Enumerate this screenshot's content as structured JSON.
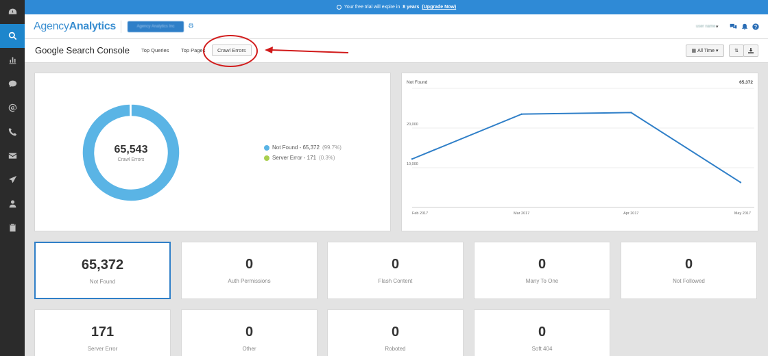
{
  "banner": {
    "prefix": "Your free trial will expire in",
    "period": "8 years",
    "link": "(Upgrade Now)"
  },
  "header": {
    "logo_light": "Agency",
    "logo_bold": "Analytics",
    "account_name": "Agency Analytics Inc",
    "user_name": "user name"
  },
  "sidebar": {
    "items": [
      {
        "icon": "dashboard-icon",
        "active": false
      },
      {
        "icon": "search-icon",
        "active": true
      },
      {
        "icon": "bar-chart-icon",
        "active": false
      },
      {
        "icon": "chat-icon",
        "active": false
      },
      {
        "icon": "at-sign-icon",
        "active": false
      },
      {
        "icon": "phone-icon",
        "active": false
      },
      {
        "icon": "email-icon",
        "active": false
      },
      {
        "icon": "send-icon",
        "active": false
      },
      {
        "icon": "user-icon",
        "active": false
      },
      {
        "icon": "clipboard-icon",
        "active": false
      }
    ]
  },
  "subheader": {
    "title": "Google Search Console",
    "tabs": [
      "Top Queries",
      "Top Pages",
      "Crawl Errors"
    ],
    "active_tab": "Crawl Errors",
    "date_range": "All Time",
    "colors": {
      "annotation": "#d11a1a"
    }
  },
  "donut": {
    "total": "65,543",
    "caption": "Crawl Errors",
    "legend": [
      {
        "label": "Not Found - 65,372",
        "pct": "(99.7%)",
        "color": "#5ab4e5"
      },
      {
        "label": "Server Error - 171",
        "pct": "(0.3%)",
        "color": "#a9cf4f"
      }
    ]
  },
  "line_chart": {
    "title": "Not Found",
    "total": "65,372"
  },
  "chart_data": [
    {
      "type": "pie",
      "title": "Crawl Errors",
      "categories": [
        "Not Found",
        "Server Error"
      ],
      "values": [
        65372,
        171
      ],
      "colors": [
        "#5ab4e5",
        "#a9cf4f"
      ]
    },
    {
      "type": "line",
      "title": "Not Found",
      "x": [
        "Feb 2017",
        "Mar 2017",
        "Apr 2017",
        "May 2017"
      ],
      "series": [
        {
          "name": "Not Found",
          "values": [
            12200,
            23500,
            23900,
            6300
          ]
        }
      ],
      "y_ticks": [
        "10,000",
        "20,000"
      ],
      "ylim": [
        0,
        30000
      ],
      "color": "#2f7fc8"
    }
  ],
  "stats": [
    {
      "value": "65,372",
      "label": "Not Found",
      "selected": true
    },
    {
      "value": "0",
      "label": "Auth Permissions",
      "selected": false
    },
    {
      "value": "0",
      "label": "Flash Content",
      "selected": false
    },
    {
      "value": "0",
      "label": "Many To One",
      "selected": false
    },
    {
      "value": "0",
      "label": "Not Followed",
      "selected": false
    },
    {
      "value": "171",
      "label": "Server Error",
      "selected": false
    },
    {
      "value": "0",
      "label": "Other",
      "selected": false
    },
    {
      "value": "0",
      "label": "Roboted",
      "selected": false
    },
    {
      "value": "0",
      "label": "Soft 404",
      "selected": false
    }
  ]
}
